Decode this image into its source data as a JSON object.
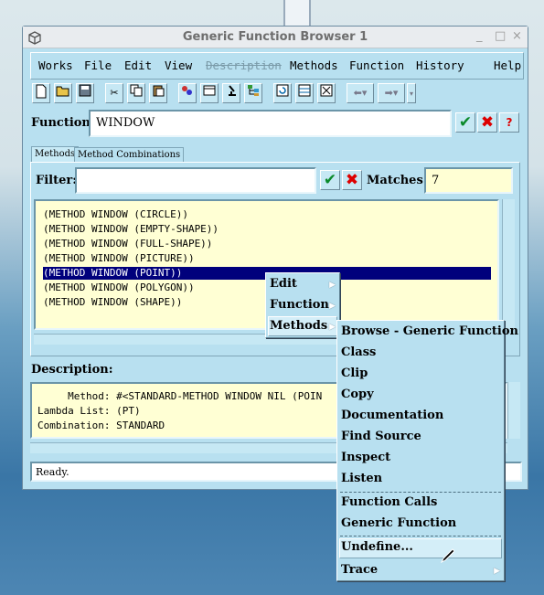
{
  "window": {
    "title": "Generic Function Browser 1",
    "controls": {
      "minimize": "_",
      "maximize": "□",
      "close": "×"
    }
  },
  "menubar": [
    "Works",
    "File",
    "Edit",
    "View",
    "Description",
    "Methods",
    "Function",
    "History",
    "Help"
  ],
  "function": {
    "label": "Function:",
    "value": "WINDOW"
  },
  "tabs": [
    "Methods",
    "Method Combinations"
  ],
  "filter": {
    "label": "Filter:",
    "value": ""
  },
  "matches": {
    "label": "Matches:",
    "value": "7"
  },
  "methods": [
    "(METHOD WINDOW (CIRCLE))",
    "(METHOD WINDOW (EMPTY-SHAPE))",
    "(METHOD WINDOW (FULL-SHAPE))",
    "(METHOD WINDOW (PICTURE))",
    "(METHOD WINDOW (POINT))",
    "(METHOD WINDOW (POLYGON))",
    "(METHOD WINDOW (SHAPE))"
  ],
  "selected_index": 4,
  "description": {
    "label": "Description:",
    "lines": [
      "     Method: #<STANDARD-METHOD WINDOW NIL (POIN",
      "Lambda List: (PT)",
      "Combination: STANDARD"
    ]
  },
  "status": "Ready.",
  "context_menu": {
    "items": [
      "Edit",
      "Function",
      "Methods"
    ]
  },
  "submenu": {
    "group1": [
      "Browse - Generic Function",
      "Class",
      "Clip",
      "Copy",
      "Documentation",
      "Find Source",
      "Inspect",
      "Listen"
    ],
    "group2": [
      "Function Calls",
      "Generic Function"
    ],
    "group3": [
      "Undefine...",
      "Trace"
    ]
  },
  "icons": [
    "new-icon",
    "open-icon",
    "save-icon",
    "cut-icon",
    "copy-icon",
    "paste-icon",
    "browse-icon",
    "inspect-icon",
    "microscope-icon",
    "tree-icon",
    "refresh-icon",
    "frames-icon",
    "graph-icon",
    "back-icon",
    "forward-icon"
  ]
}
